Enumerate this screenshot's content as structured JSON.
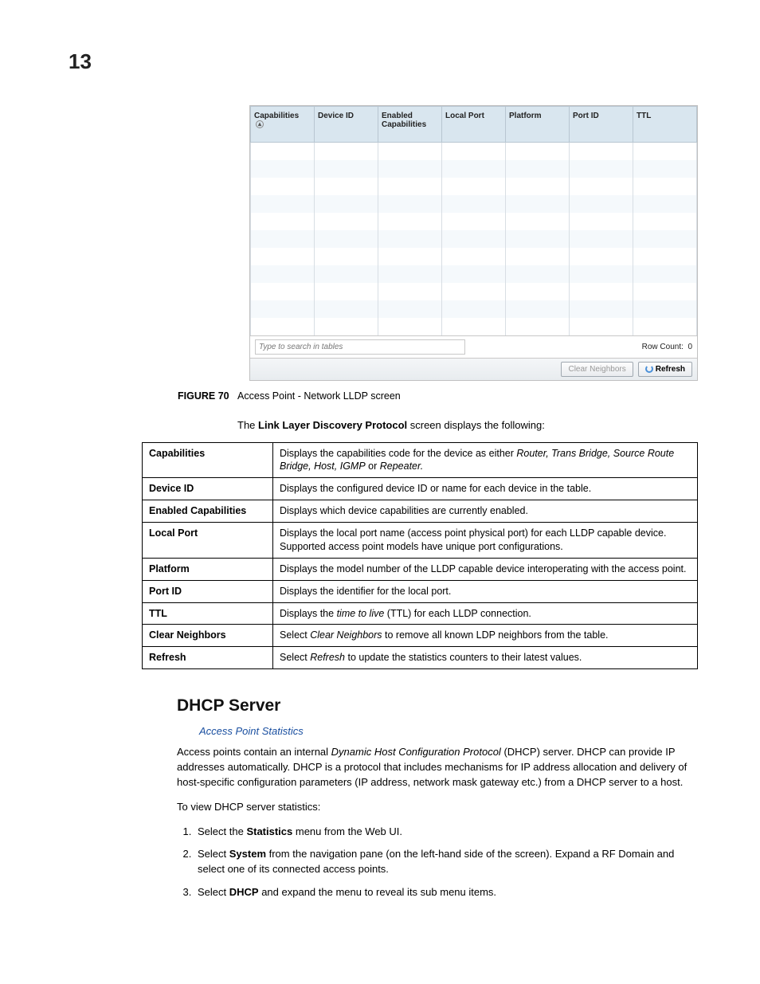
{
  "page_number": "13",
  "screenshot": {
    "columns": [
      "Capabilities",
      "Device ID",
      "Enabled Capabilities",
      "Local Port",
      "Platform",
      "Port ID",
      "TTL"
    ],
    "search_placeholder": "Type to search in tables",
    "row_count_label": "Row Count:",
    "row_count_value": "0",
    "clear_button": "Clear Neighbors",
    "refresh_button": "Refresh"
  },
  "figure": {
    "label": "FIGURE 70",
    "caption": "Access Point - Network LLDP screen"
  },
  "intro": {
    "prefix": "The ",
    "bold": "Link Layer Discovery Protocol",
    "suffix": " screen displays the following:"
  },
  "definitions": [
    {
      "term": "Capabilities",
      "desc_pre": "Displays the capabilities code for the device as either ",
      "desc_ital": "Router, Trans Bridge, Source Route Bridge, Host, IGMP",
      "desc_post": " or ",
      "desc_ital2": "Repeater.",
      "desc_end": ""
    },
    {
      "term": "Device ID",
      "desc": "Displays the configured device ID or name for each device in the table."
    },
    {
      "term": "Enabled Capabilities",
      "desc": "Displays which device capabilities are currently enabled."
    },
    {
      "term": "Local Port",
      "desc": "Displays the local port name (access point physical port) for each LLDP capable device. Supported access point models have unique port configurations."
    },
    {
      "term": "Platform",
      "desc": "Displays the model number of the LLDP capable device interoperating with the access point."
    },
    {
      "term": "Port ID",
      "desc": "Displays the identifier for the local port."
    },
    {
      "term": "TTL",
      "desc_pre": "Displays the ",
      "desc_ital": "time to live",
      "desc_post": " (TTL) for each LLDP connection."
    },
    {
      "term": "Clear Neighbors",
      "desc_pre": "Select ",
      "desc_ital": "Clear Neighbors",
      "desc_post": " to remove all known LDP neighbors from the table."
    },
    {
      "term": "Refresh",
      "desc_pre": "Select ",
      "desc_ital": "Refresh",
      "desc_post": " to update the statistics counters to their latest values."
    }
  ],
  "section": {
    "heading": "DHCP Server",
    "sublink": "Access Point Statistics",
    "para1_pre": "Access points contain an internal ",
    "para1_ital": "Dynamic Host Configuration Protocol",
    "para1_post": " (DHCP) server. DHCP can provide IP addresses automatically. DHCP is a protocol that includes mechanisms for IP address allocation and delivery of host-specific configuration parameters (IP address, network mask gateway etc.) from a DHCP server to a host.",
    "para2": "To view DHCP server statistics:",
    "steps": [
      {
        "pre": "Select the ",
        "bold": "Statistics",
        "post": " menu from the Web UI."
      },
      {
        "pre": "Select ",
        "bold": "System",
        "post": " from the navigation pane (on the left-hand side of the screen). Expand a RF Domain and select one of its connected access points."
      },
      {
        "pre": "Select ",
        "bold": "DHCP",
        "post": " and expand the menu to reveal its sub menu items."
      }
    ]
  }
}
